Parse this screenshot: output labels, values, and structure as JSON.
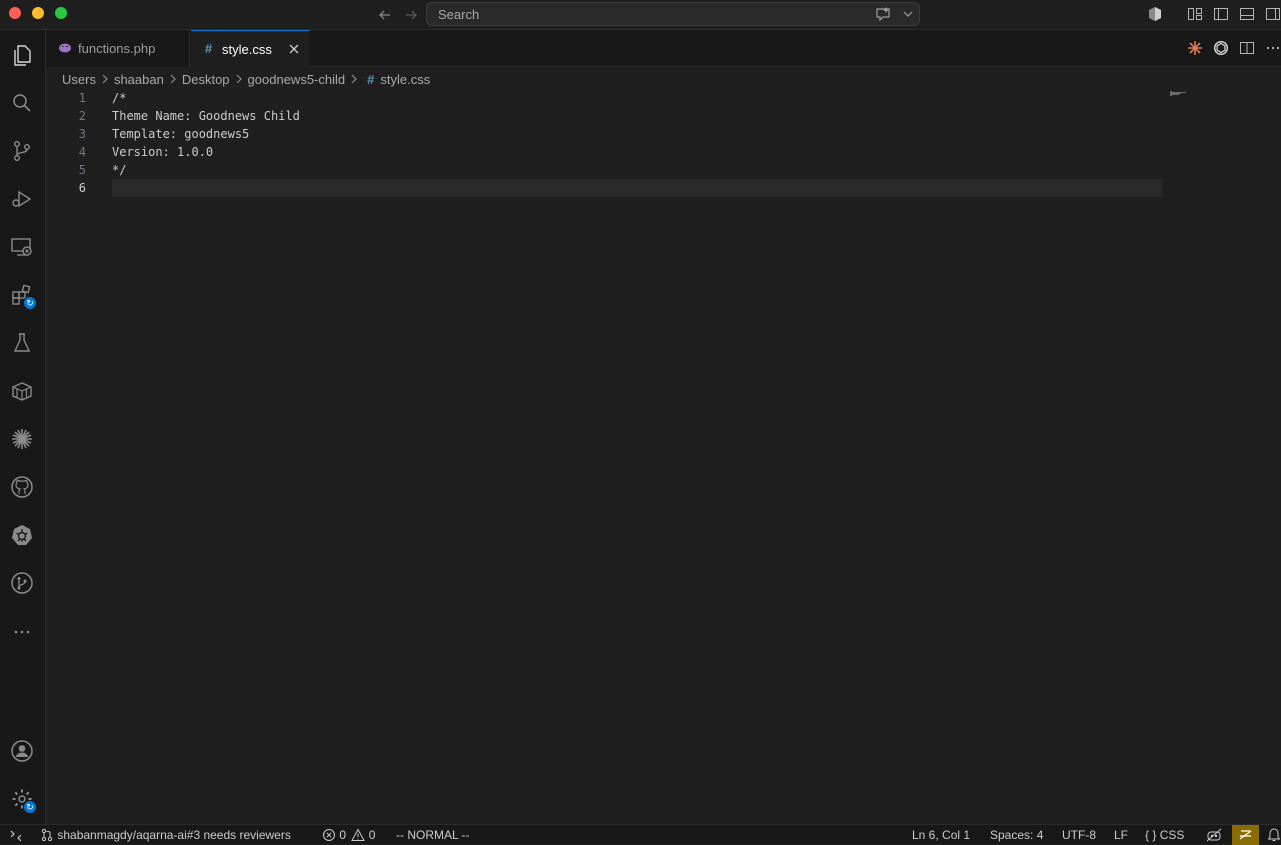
{
  "titlebar": {
    "search_placeholder": "Search"
  },
  "tabs": [
    {
      "label": "functions.php",
      "active": false,
      "icon": "php-icon"
    },
    {
      "label": "style.css",
      "active": true,
      "icon": "css-hash-icon"
    }
  ],
  "breadcrumb": [
    "Users",
    "shaaban",
    "Desktop",
    "goodnews5-child",
    "style.css"
  ],
  "editor": {
    "lines": [
      {
        "n": "1",
        "text": "/*"
      },
      {
        "n": "2",
        "text": "Theme Name: Goodnews Child"
      },
      {
        "n": "3",
        "text": "Template: goodnews5"
      },
      {
        "n": "4",
        "text": "Version: 1.0.0"
      },
      {
        "n": "5",
        "text": "*/"
      },
      {
        "n": "6",
        "text": ""
      }
    ]
  },
  "statusbar": {
    "pr": "shabanmagdy/aqarna-ai#3 needs reviewers",
    "errors": "0",
    "warnings": "0",
    "vim_mode": "-- NORMAL --",
    "position": "Ln 6, Col 1",
    "spaces": "Spaces: 4",
    "encoding": "UTF-8",
    "eol": "LF",
    "language": "CSS",
    "language_brace": "{ }"
  },
  "colors": {
    "accent": "#0078d4",
    "background": "#1f1f1f",
    "php_icon": "#a074c4",
    "css_hash": "#519aba"
  }
}
